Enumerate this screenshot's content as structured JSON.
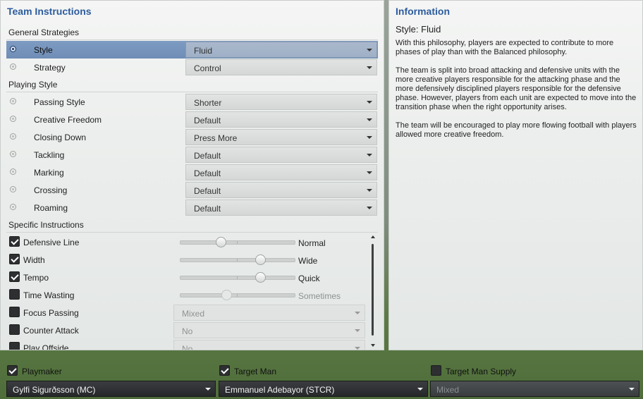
{
  "left": {
    "title": "Team Instructions",
    "general_header": "General Strategies",
    "general_rows": [
      {
        "label": "Style",
        "value": "Fluid"
      },
      {
        "label": "Strategy",
        "value": "Control"
      }
    ],
    "playing_header": "Playing Style",
    "playing_rows": [
      {
        "label": "Passing Style",
        "value": "Shorter"
      },
      {
        "label": "Creative Freedom",
        "value": "Default"
      },
      {
        "label": "Closing Down",
        "value": "Press More"
      },
      {
        "label": "Tackling",
        "value": "Default"
      },
      {
        "label": "Marking",
        "value": "Default"
      },
      {
        "label": "Crossing",
        "value": "Default"
      },
      {
        "label": "Roaming",
        "value": "Default"
      }
    ],
    "specific_header": "Specific Instructions",
    "specific_rows": [
      {
        "label": "Defensive Line",
        "checked": true,
        "slider_value": "Normal",
        "slider_fraction": 0.35
      },
      {
        "label": "Width",
        "checked": true,
        "slider_value": "Wide",
        "slider_fraction": 0.7
      },
      {
        "label": "Tempo",
        "checked": true,
        "slider_value": "Quick",
        "slider_fraction": 0.7
      },
      {
        "label": "Time Wasting",
        "checked": false,
        "slider_value": "Sometimes",
        "slider_fraction": 0.4
      },
      {
        "label": "Focus Passing",
        "checked": false,
        "dropdown_value": "Mixed"
      },
      {
        "label": "Counter Attack",
        "checked": false,
        "dropdown_value": "No"
      },
      {
        "label": "Play Offside",
        "checked": false,
        "dropdown_value": "No"
      }
    ]
  },
  "right": {
    "title": "Information",
    "subtitle": "Style: Fluid",
    "paragraphs": [
      "With this philosophy, players are expected to contribute to more phases of play than with the Balanced philosophy.",
      "The team is split into broad attacking and defensive units with the more creative players responsible for the attacking phase and the more defensively disciplined players responsible for the defensive phase. However, players from each unit are expected to move into the transition phase when the right opportunity arises.",
      "The team will be encouraged to play more flowing football with players allowed more creative freedom."
    ]
  },
  "bottom": {
    "roles": [
      {
        "label": "Playmaker",
        "checked": true,
        "player": "Gylfi Sigurðsson (MC)",
        "disabled": false
      },
      {
        "label": "Target Man",
        "checked": true,
        "player": "Emmanuel Adebayor (STCR)",
        "disabled": false
      },
      {
        "label": "Target Man Supply",
        "checked": false,
        "player": "Mixed",
        "disabled": true
      }
    ]
  },
  "colors": {
    "accent": "#2d5c9e",
    "selected_row": "#7e9bc2"
  }
}
